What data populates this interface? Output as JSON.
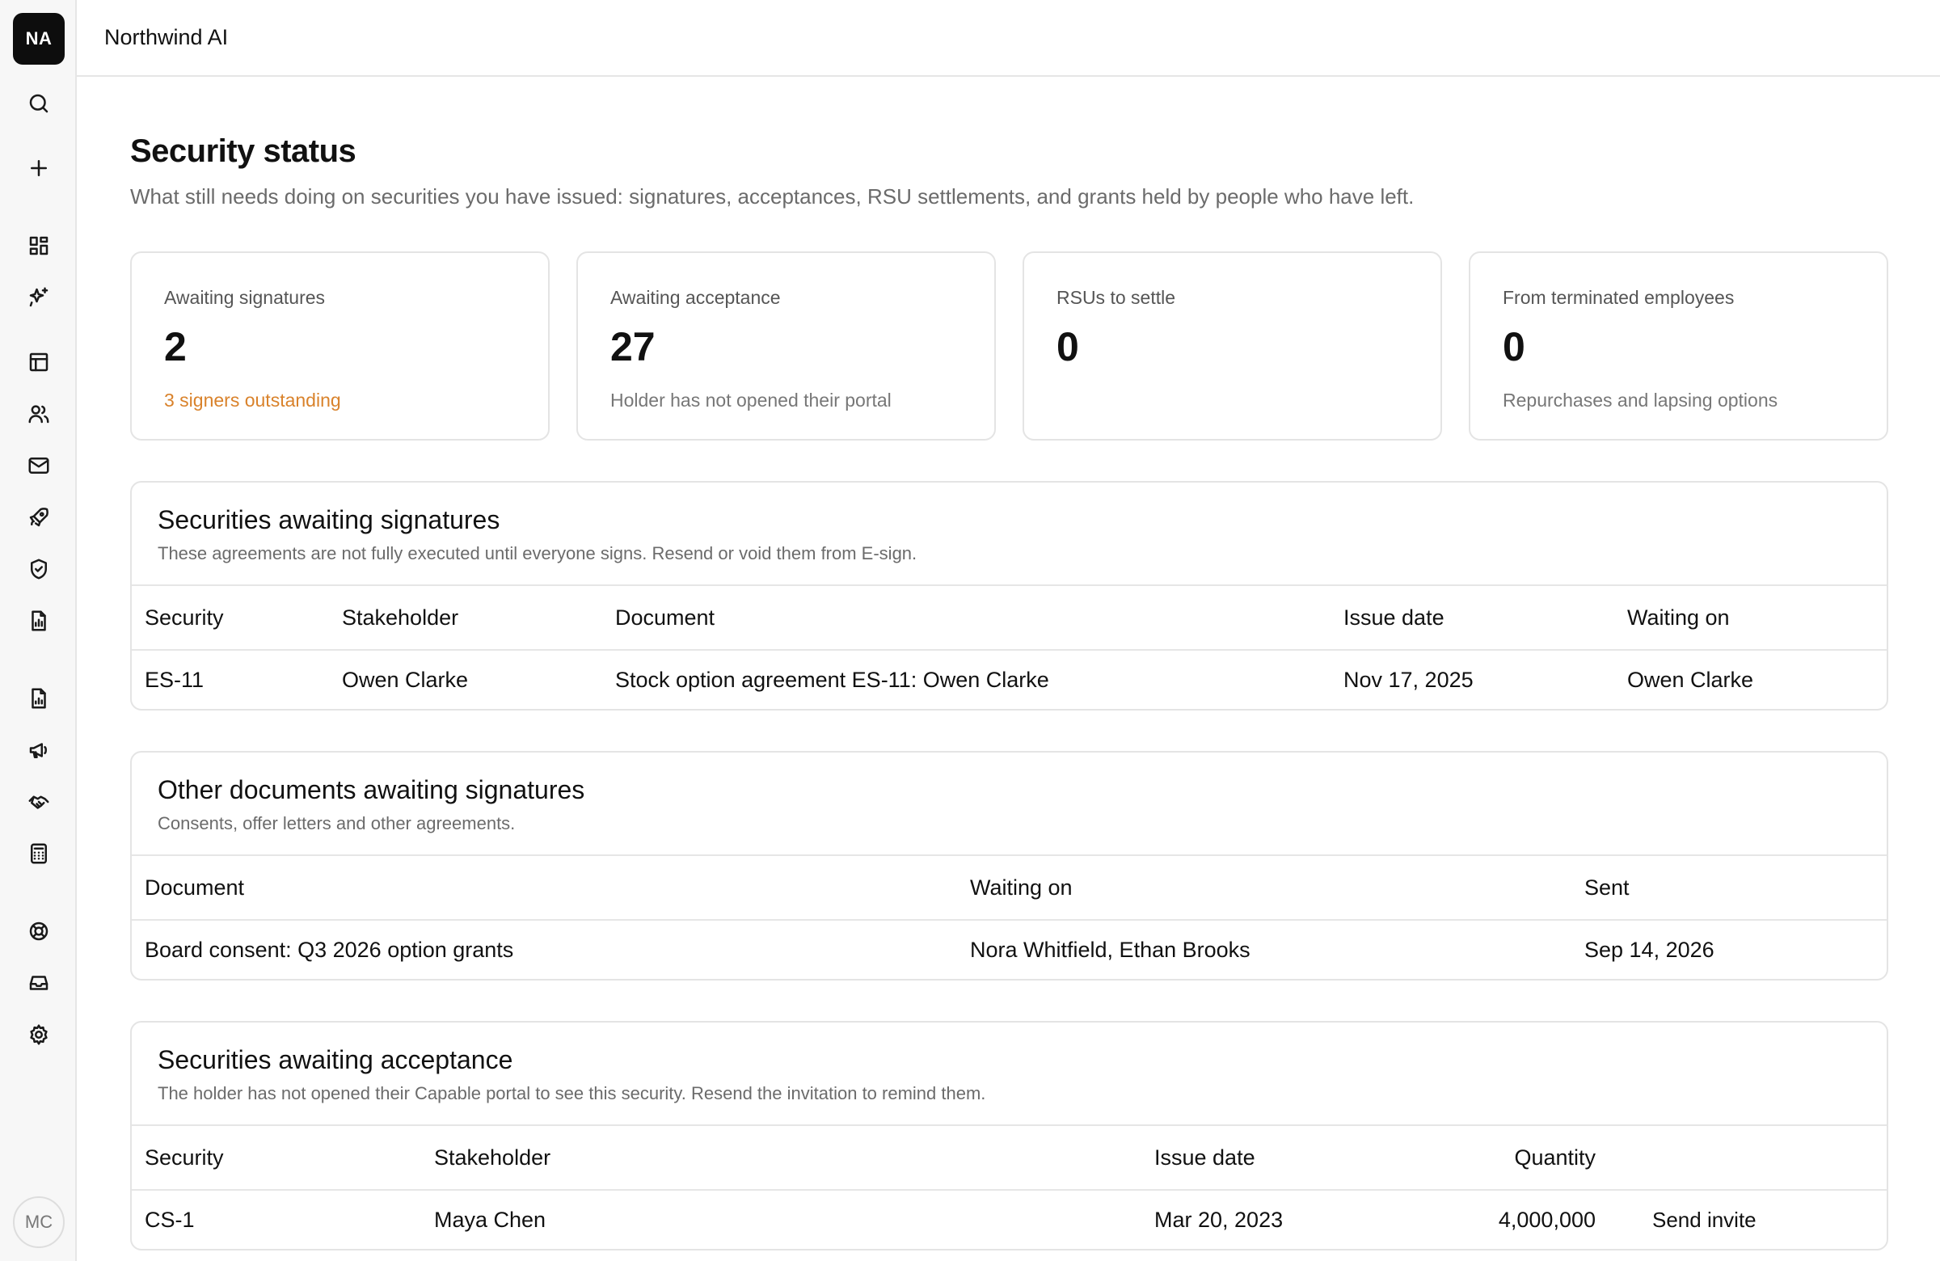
{
  "sidebar": {
    "org_initials": "NA",
    "user_initials": "MC",
    "icons": [
      "search-icon",
      "plus-icon",
      "dashboard-icon",
      "sparkles-icon",
      "table-icon",
      "people-icon",
      "mail-icon",
      "rocket-icon",
      "shield-icon",
      "report-icon",
      "document-chart-icon",
      "megaphone-icon",
      "handshake-icon",
      "calculator-icon",
      "lifebuoy-icon",
      "inbox-icon",
      "gear-icon"
    ]
  },
  "header": {
    "org_name": "Northwind AI"
  },
  "page": {
    "title": "Security status",
    "subtitle": "What still needs doing on securities you have issued: signatures, acceptances, RSU settlements, and grants held by people who have left."
  },
  "stats": [
    {
      "label": "Awaiting signatures",
      "value": "2",
      "note": "3 signers outstanding"
    },
    {
      "label": "Awaiting acceptance",
      "value": "27",
      "note": "Holder has not opened their portal"
    },
    {
      "label": "RSUs to settle",
      "value": "0",
      "note": ""
    },
    {
      "label": "From terminated employees",
      "value": "0",
      "note": "Repurchases and lapsing options"
    }
  ],
  "sig_section": {
    "title": "Securities awaiting signatures",
    "desc": "These agreements are not fully executed until everyone signs. Resend or void them from E-sign.",
    "headers": [
      "Security",
      "Stakeholder",
      "Document",
      "Issue date",
      "Waiting on"
    ],
    "rows": [
      [
        "ES-11",
        "Owen Clarke",
        "Stock option agreement ES-11: Owen Clarke",
        "Nov 17, 2025",
        "Owen Clarke"
      ]
    ]
  },
  "doc_section": {
    "title": "Other documents awaiting signatures",
    "desc": "Consents, offer letters and other agreements.",
    "headers": [
      "Document",
      "Waiting on",
      "Sent"
    ],
    "rows": [
      [
        "Board consent: Q3 2026 option grants",
        "Nora Whitfield, Ethan Brooks",
        "Sep 14, 2026"
      ]
    ]
  },
  "acc_section": {
    "title": "Securities awaiting acceptance",
    "desc": "The holder has not opened their Capable portal to see this security. Resend the invitation to remind them.",
    "headers": [
      "Security",
      "Stakeholder",
      "Issue date",
      "Quantity"
    ],
    "rows": [
      [
        "CS-1",
        "Maya Chen",
        "Mar 20, 2023",
        "4,000,000"
      ]
    ],
    "action_label": "Send invite"
  },
  "colors": {
    "warn": "#d9822b",
    "border": "#e4e4e4"
  }
}
